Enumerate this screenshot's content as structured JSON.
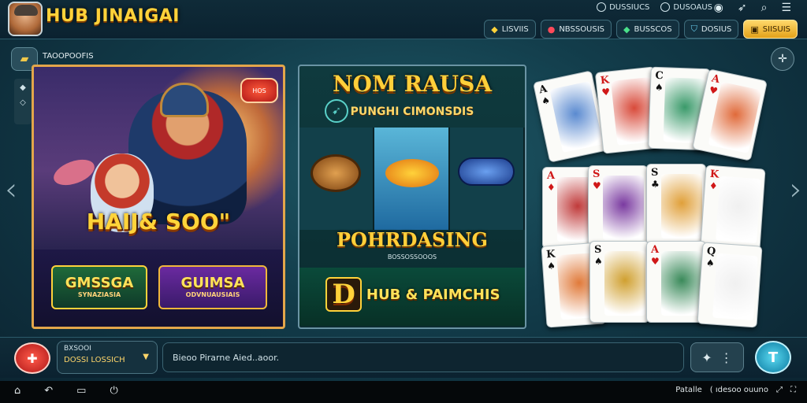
{
  "header": {
    "title": "HUB JINAIGAI",
    "links": [
      {
        "icon": "globe-icon",
        "label": "DUSSIUCS"
      },
      {
        "icon": "info-icon",
        "label": "DUSOAUS"
      }
    ],
    "icons": [
      "user-icon",
      "bell-icon",
      "search-icon",
      "menu-icon"
    ],
    "pills": [
      {
        "icon": "diamond-icon",
        "label": "LISVIIS"
      },
      {
        "icon": "ruby-icon",
        "label": "NBSSOUSIS"
      },
      {
        "icon": "gem-icon",
        "label": "BUSSCOS"
      },
      {
        "icon": "shield-icon",
        "label": "DOSIUS"
      },
      {
        "icon": "wallet-icon",
        "label": "SIISUIS"
      }
    ]
  },
  "subbar": {
    "label": "TAOOPOOFIS",
    "settings_icon": "settings-icon"
  },
  "panel1": {
    "badge": "HOS",
    "banner": "HAIJ& SOO\"",
    "logo1_main": "GMSSGA",
    "logo1_sub": "SYNAZIASIA",
    "logo2_main": "GUIMSA",
    "logo2_sub": "ODVNUAUSIAIS"
  },
  "panel2": {
    "title": "NOM RAUSA",
    "subtitle": "PUNGHI CIMONSDIS",
    "banner": "POHRDASING",
    "small": "BOSSOSSOOOS",
    "logo_d": "D",
    "logo_text": "HUB & PAIMCHIS"
  },
  "cards": [
    {
      "rank": "A",
      "suit": "♠",
      "color": "black"
    },
    {
      "rank": "K",
      "suit": "♥",
      "color": "red"
    },
    {
      "rank": "C",
      "suit": "♠",
      "color": "black"
    },
    {
      "rank": "A",
      "suit": "♥",
      "color": "red"
    },
    {
      "rank": "A",
      "suit": "♦",
      "color": "red"
    },
    {
      "rank": "S",
      "suit": "♥",
      "color": "red"
    },
    {
      "rank": "S",
      "suit": "♣",
      "color": "black"
    },
    {
      "rank": "K",
      "suit": "♦",
      "color": "red"
    },
    {
      "rank": "K",
      "suit": "♠",
      "color": "black"
    },
    {
      "rank": "S",
      "suit": "♠",
      "color": "black"
    },
    {
      "rank": "A",
      "suit": "♥",
      "color": "red"
    },
    {
      "rank": "Q",
      "suit": "♠",
      "color": "black"
    }
  ],
  "footer": {
    "select_label": "BXSOOI",
    "select_value": "DOSSI LOSSICH",
    "message": "Bieoo Pirarne Aied..aoor.",
    "emoji_icons": [
      "puzzle-icon",
      "more-icon"
    ],
    "send_icon": "send-icon"
  },
  "system": {
    "right_label": "Patalle",
    "right_text": "( ıdesoo ouuno"
  }
}
